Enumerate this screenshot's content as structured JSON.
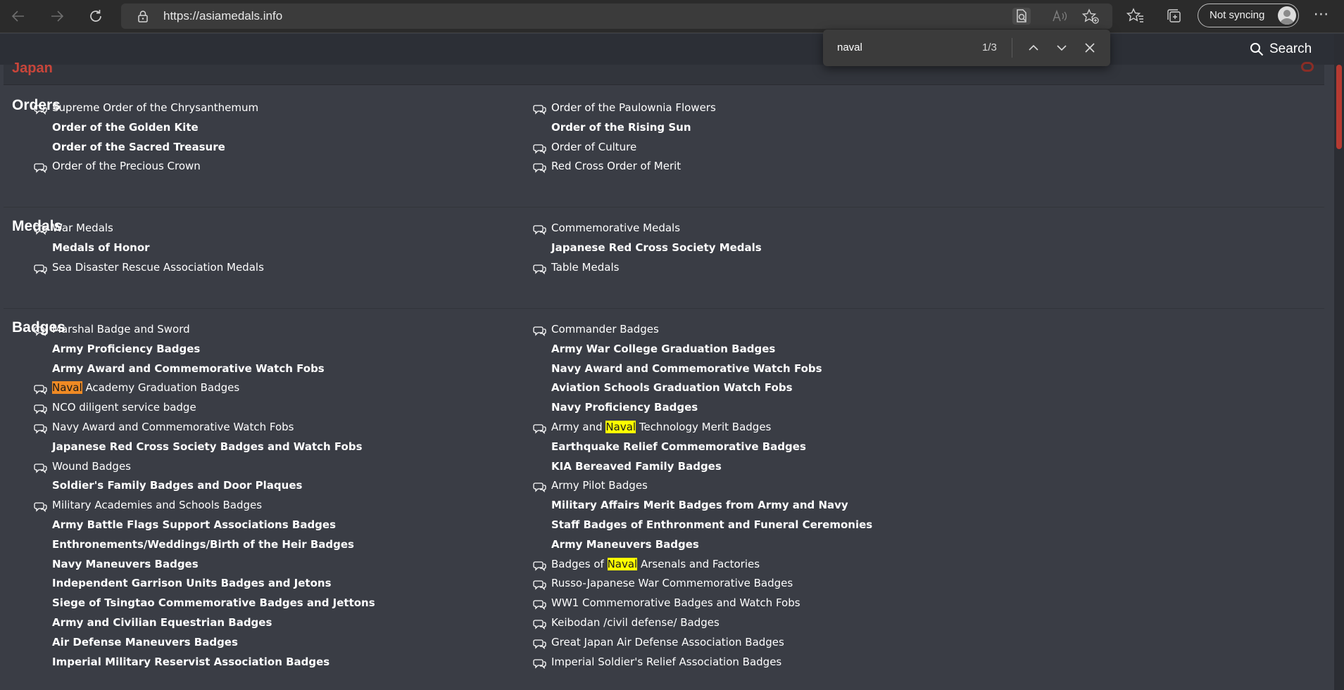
{
  "browser": {
    "url": "https://asiamedals.info",
    "sync_label": "Not syncing",
    "icons": {
      "back": "back-arrow-icon",
      "forward": "forward-arrow-icon",
      "refresh": "refresh-icon",
      "lock": "lock-icon",
      "find": "find-in-page-icon",
      "read_aloud": "read-aloud-icon",
      "add_favorite": "add-favorite-icon",
      "favorites": "favorites-icon",
      "collections": "collections-icon",
      "more": "more-icon"
    }
  },
  "find_bar": {
    "query": "naval",
    "count": "1/3"
  },
  "site": {
    "search_label": "Search"
  },
  "region": {
    "title": "Japan"
  },
  "sections": {
    "orders": {
      "title": "Orders",
      "left": [
        {
          "text": "Supreme Order of the Chrysanthemum",
          "icon": true
        },
        {
          "text": "Order of the Golden Kite",
          "icon": false
        },
        {
          "text": "Order of the Sacred Treasure",
          "icon": false
        },
        {
          "text": "Order of the Precious Crown",
          "icon": true
        }
      ],
      "right": [
        {
          "text": "Order of the Paulownia Flowers",
          "icon": true
        },
        {
          "text": "Order of the Rising Sun",
          "icon": false
        },
        {
          "text": "Order of Culture",
          "icon": true
        },
        {
          "text": "Red Cross Order of Merit",
          "icon": true
        }
      ]
    },
    "medals": {
      "title": "Medals",
      "left": [
        {
          "text": "War Medals",
          "icon": true
        },
        {
          "text": "Medals of Honor",
          "icon": false
        },
        {
          "text": "Sea Disaster Rescue Association Medals",
          "icon": true
        }
      ],
      "right": [
        {
          "text": "Commemorative Medals",
          "icon": true
        },
        {
          "text": "Japanese Red Cross Society Medals",
          "icon": false
        },
        {
          "text": "Table Medals",
          "icon": true
        }
      ]
    },
    "badges": {
      "title": "Badges",
      "left": [
        {
          "text": "Marshal Badge and Sword",
          "icon": true
        },
        {
          "text": "Army Proficiency Badges",
          "icon": false
        },
        {
          "text": "Army Award and Commemorative Watch Fobs",
          "icon": false
        },
        {
          "text": "Academy Graduation Badges",
          "icon": true,
          "hl": "Naval",
          "hl_current": true
        },
        {
          "text": "NCO diligent service badge",
          "icon": true
        },
        {
          "text": "Navy Award and Commemorative Watch Fobs",
          "icon": true
        },
        {
          "text": "Japanese Red Cross Society Badges and Watch Fobs",
          "icon": false
        },
        {
          "text": "Wound Badges",
          "icon": true
        },
        {
          "text": "Soldier's Family Badges and Door Plaques",
          "icon": false
        },
        {
          "text": "Military Academies and Schools Badges",
          "icon": true
        },
        {
          "text": "Army Battle Flags Support Associations Badges",
          "icon": false
        },
        {
          "text": "Enthronements/Weddings/Birth of the Heir Badges",
          "icon": false
        },
        {
          "text": "Navy Maneuvers Badges",
          "icon": false
        },
        {
          "text": "Independent Garrison Units Badges and Jetons",
          "icon": false
        },
        {
          "text": "Siege of Tsingtao Commemorative Badges and Jettons",
          "icon": false
        },
        {
          "text": "Army and Civilian Equestrian Badges",
          "icon": false
        },
        {
          "text": "Air Defense Maneuvers Badges",
          "icon": false
        },
        {
          "text": "Imperial Military Reservist Association Badges",
          "icon": false
        }
      ],
      "right": [
        {
          "text": "Commander Badges",
          "icon": true
        },
        {
          "text": "Army War College Graduation Badges",
          "icon": false
        },
        {
          "text": "Navy Award and Commemorative Watch Fobs",
          "icon": false
        },
        {
          "text": "Aviation Schools Graduation Watch Fobs",
          "icon": false
        },
        {
          "text": "Navy Proficiency Badges",
          "icon": false
        },
        {
          "text": "Army and ",
          "icon": true,
          "hl": "Naval",
          "after": " Technology Merit Badges"
        },
        {
          "text": "Earthquake Relief Commemorative Badges",
          "icon": false
        },
        {
          "text": "KIA Bereaved Family Badges",
          "icon": false
        },
        {
          "text": "Army Pilot Badges",
          "icon": true
        },
        {
          "text": "Military Affairs Merit Badges from Army and Navy",
          "icon": false
        },
        {
          "text": "Staff Badges of Enthronment and Funeral Ceremonies",
          "icon": false
        },
        {
          "text": "Army Maneuvers Badges",
          "icon": false
        },
        {
          "text": "Badges of ",
          "icon": true,
          "hl": "Naval",
          "after": " Arsenals and Factories"
        },
        {
          "text": "Russo-Japanese War Commemorative Badges",
          "icon": true
        },
        {
          "text": "WW1 Commemorative Badges and Watch Fobs",
          "icon": true
        },
        {
          "text": "Keibodan /civil defense/ Badges",
          "icon": true
        },
        {
          "text": "Great Japan Air Defense Association Badges",
          "icon": true
        },
        {
          "text": "Imperial Soldier's Relief Association Badges",
          "icon": true
        }
      ]
    }
  },
  "colors": {
    "page_bg": "#3a3d45",
    "region_title": "#c8453a",
    "highlight_current": "#f08a24",
    "highlight": "#ffff00",
    "scroll_thumb": "#b63a31"
  }
}
